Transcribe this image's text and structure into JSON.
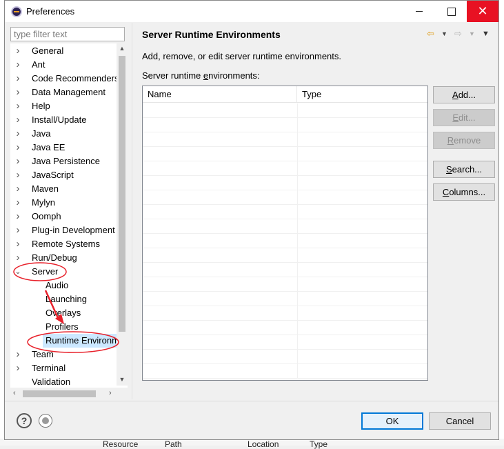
{
  "window": {
    "title": "Preferences"
  },
  "tree": {
    "filter_placeholder": "type filter text",
    "items": [
      {
        "label": "General",
        "expander": "collapsed"
      },
      {
        "label": "Ant",
        "expander": "collapsed"
      },
      {
        "label": "Code Recommenders",
        "expander": "collapsed"
      },
      {
        "label": "Data Management",
        "expander": "collapsed"
      },
      {
        "label": "Help",
        "expander": "collapsed"
      },
      {
        "label": "Install/Update",
        "expander": "collapsed"
      },
      {
        "label": "Java",
        "expander": "collapsed"
      },
      {
        "label": "Java EE",
        "expander": "collapsed"
      },
      {
        "label": "Java Persistence",
        "expander": "collapsed"
      },
      {
        "label": "JavaScript",
        "expander": "collapsed"
      },
      {
        "label": "Maven",
        "expander": "collapsed"
      },
      {
        "label": "Mylyn",
        "expander": "collapsed"
      },
      {
        "label": "Oomph",
        "expander": "collapsed"
      },
      {
        "label": "Plug-in Development",
        "expander": "collapsed"
      },
      {
        "label": "Remote Systems",
        "expander": "collapsed"
      },
      {
        "label": "Run/Debug",
        "expander": "collapsed"
      },
      {
        "label": "Server",
        "expander": "expanded"
      },
      {
        "label": "Audio",
        "expander": "none",
        "child": true
      },
      {
        "label": "Launching",
        "expander": "none",
        "child": true
      },
      {
        "label": "Overlays",
        "expander": "none",
        "child": true
      },
      {
        "label": "Profilers",
        "expander": "none",
        "child": true
      },
      {
        "label": "Runtime Environm",
        "expander": "none",
        "child": true,
        "selected": true
      },
      {
        "label": "Team",
        "expander": "collapsed"
      },
      {
        "label": "Terminal",
        "expander": "collapsed"
      },
      {
        "label": "Validation",
        "expander": "none"
      }
    ]
  },
  "page": {
    "title": "Server Runtime Environments",
    "description": "Add, remove, or edit server runtime environments.",
    "list_label_pre": "Server runtime ",
    "list_label_mnemonic": "e",
    "list_label_post": "nvironments:",
    "columns": [
      "Name",
      "Type"
    ],
    "rows": []
  },
  "buttons": {
    "add": {
      "pre": "",
      "mn": "A",
      "post": "dd..."
    },
    "edit": {
      "pre": "",
      "mn": "E",
      "post": "dit..."
    },
    "remove": {
      "pre": "",
      "mn": "R",
      "post": "emove"
    },
    "search": {
      "pre": "",
      "mn": "S",
      "post": "earch..."
    },
    "columns": {
      "pre": "",
      "mn": "C",
      "post": "olumns..."
    }
  },
  "footer": {
    "ok": "OK",
    "cancel": "Cancel",
    "help_glyph": "?"
  },
  "background": {
    "columns": [
      "Resource",
      "Path",
      "Location",
      "Type"
    ]
  },
  "colors": {
    "selection": "#cce8ff",
    "close_button": "#e81123",
    "annotation": "#e8202a",
    "ok_border": "#0078d7"
  }
}
